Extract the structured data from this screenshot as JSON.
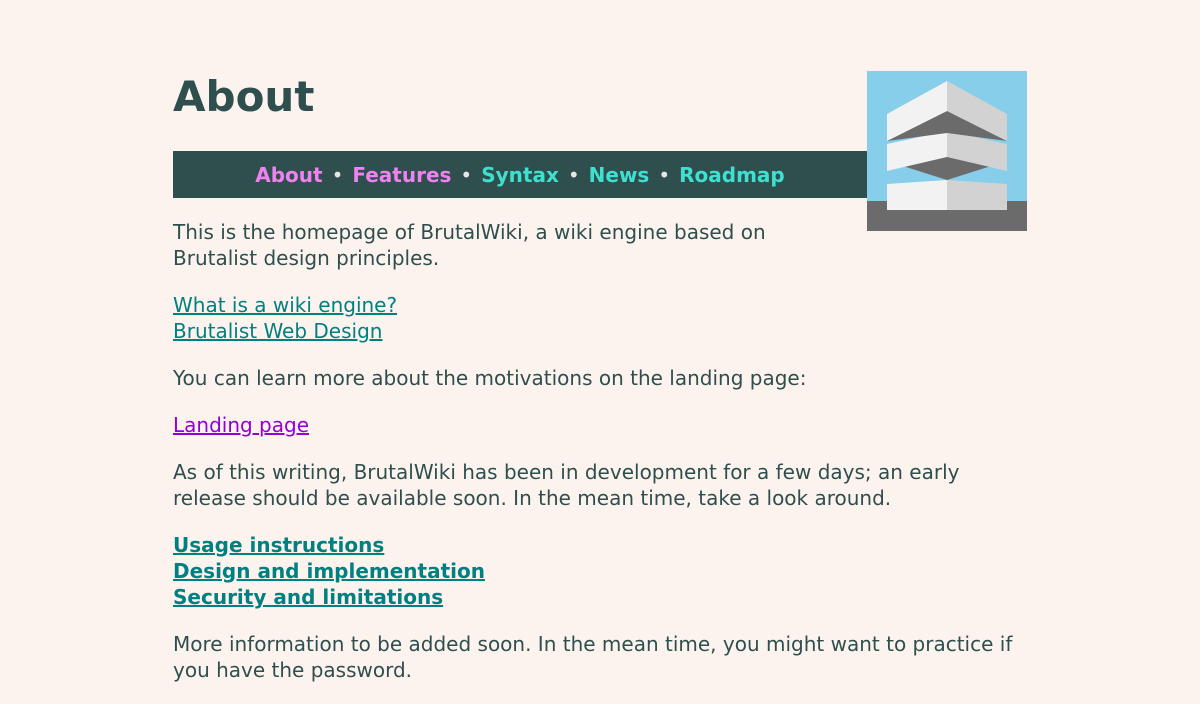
{
  "page": {
    "title": "About"
  },
  "nav": {
    "items": [
      {
        "label": "About",
        "state": "visited"
      },
      {
        "label": "Features",
        "state": "visited"
      },
      {
        "label": "Syntax",
        "state": "unvisited"
      },
      {
        "label": "News",
        "state": "unvisited"
      },
      {
        "label": "Roadmap",
        "state": "unvisited"
      }
    ],
    "separator": "•"
  },
  "content": {
    "intro": "This is the homepage of BrutalWiki, a wiki engine based on Brutalist design principles.",
    "links1": [
      "What is a wiki engine?",
      "Brutalist Web Design"
    ],
    "motivation": "You can learn more about the motivations on the landing page:",
    "landing_link": "Landing page",
    "status": "As of this writing, BrutalWiki has been in development for a few days; an early release should be available soon. In the mean time, take a look around.",
    "links2": [
      "Usage instructions",
      "Design and implementation",
      "Security and limitations"
    ],
    "more": "More information to be added soon. In the mean time, you might want to practice if you have the password."
  },
  "colors": {
    "background": "#fdf3ee",
    "text": "#2f4f4f",
    "nav_bg": "#2f4f4f",
    "link": "#008080",
    "visited_link": "#9400d3",
    "nav_visited": "#ee82ee",
    "nav_unvisited": "#40e0d0",
    "logo_sky": "#87ceeb",
    "logo_ground": "#6b6b6b"
  },
  "icons": {
    "logo": "brutalist-stacked-building-icon"
  }
}
